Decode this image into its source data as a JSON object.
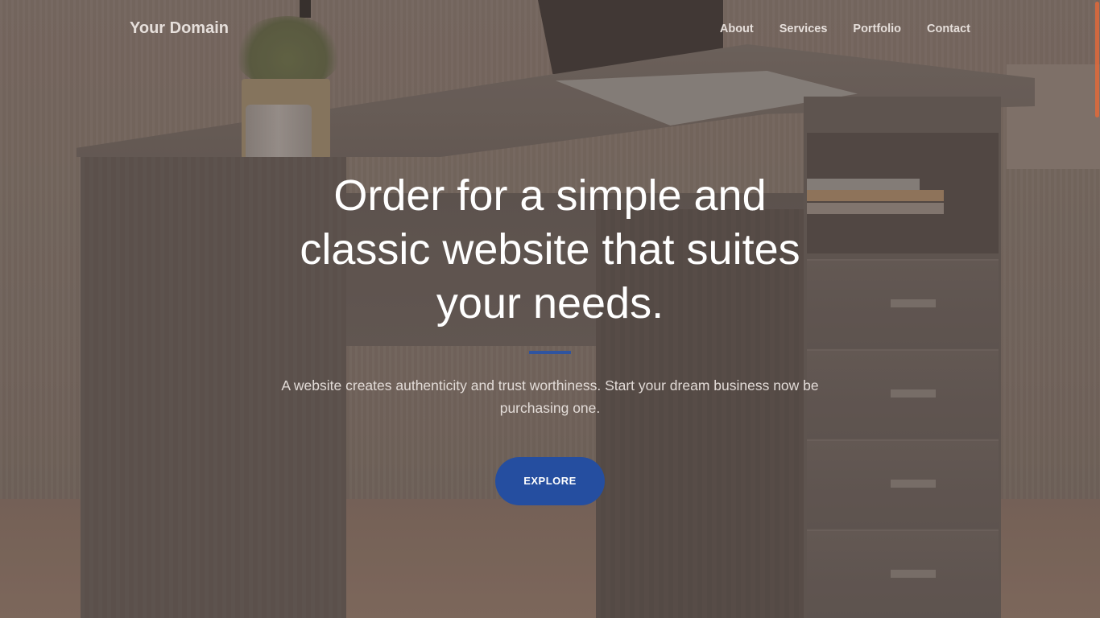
{
  "navbar": {
    "brand": "Your Domain",
    "links": [
      {
        "label": "About"
      },
      {
        "label": "Services"
      },
      {
        "label": "Portfolio"
      },
      {
        "label": "Contact"
      }
    ]
  },
  "hero": {
    "headline": "Order for a simple and classic website that suites your needs.",
    "subtitle": "A website creates authenticity and trust worthiness. Start your dream business now be purchasing one.",
    "cta_label": "EXPLORE"
  },
  "colors": {
    "accent": "#254ea0",
    "divider": "#2f54a0",
    "scroll_thumb": "#e0693a"
  }
}
